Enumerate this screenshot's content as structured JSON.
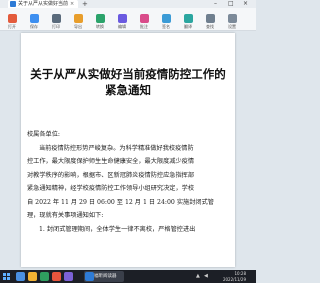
{
  "tab": {
    "title": "关于从严从实做好当前疫情防控..."
  },
  "toolbar": {
    "items": [
      {
        "label": "打开",
        "color": "#e35b3c"
      },
      {
        "label": "保存",
        "color": "#3d8ff0"
      },
      {
        "label": "打印",
        "color": "#5a6b7c"
      },
      {
        "label": "导出",
        "color": "#e89e2c"
      },
      {
        "label": "转换",
        "color": "#2ba36b"
      },
      {
        "label": "编辑",
        "color": "#6a5ae0"
      },
      {
        "label": "批注",
        "color": "#d94c8a"
      },
      {
        "label": "签名",
        "color": "#3b9bd6"
      },
      {
        "label": "翻译",
        "color": "#2ba6a0"
      },
      {
        "label": "查找",
        "color": "#6f7f8f"
      },
      {
        "label": "设置",
        "color": "#7c8a99"
      }
    ]
  },
  "doc": {
    "title_line1": "关于从严从实做好当前疫情防控工作的",
    "title_line2": "紧急通知",
    "salutation": "校属各单位:",
    "lines": [
      "当前疫情防控形势严峻复杂。为科学精准做好我校疫情防",
      "控工作，最大限度保护师生生命健康安全，最大限度减少疫情",
      "对教学秩序的影响，根据市、区新冠肺炎疫情防控应急指挥部",
      "紧急通知精神，经学校疫情防控工作领导小组研究决定，学校",
      "自 2022 年 11 月 29 日 06:00 至 12 月 1 日 24:00 实施封闭式管",
      "理，现就有关事项通知如下:",
      "1. 封闭式管理期间，全体学生一律不离校，严格管控进出"
    ]
  },
  "taskbar": {
    "app_label": "福昕阅读器",
    "time": "10:28",
    "date": "2022/11/29"
  }
}
